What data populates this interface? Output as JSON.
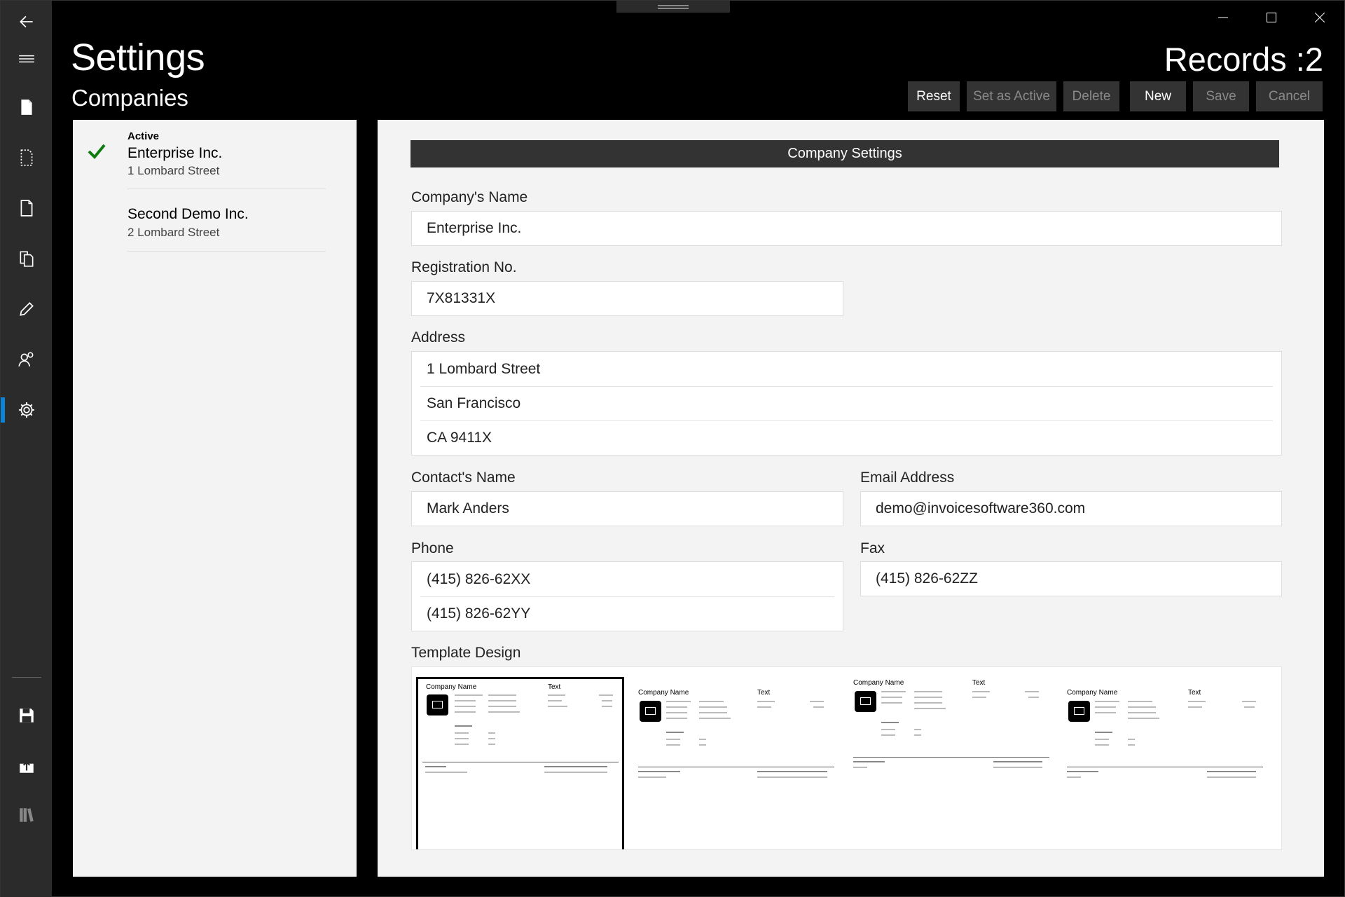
{
  "window": {
    "controls": [
      "minimize",
      "maximize",
      "close"
    ]
  },
  "nav": {
    "items": [
      {
        "icon": "back-arrow-icon"
      },
      {
        "icon": "hamburger-menu-icon"
      },
      {
        "icon": "document-icon"
      },
      {
        "icon": "document-dashed-icon"
      },
      {
        "icon": "document-outline-icon"
      },
      {
        "icon": "copy-documents-icon"
      },
      {
        "icon": "pencil-icon"
      },
      {
        "icon": "people-icon"
      },
      {
        "icon": "gear-icon",
        "selected": true
      },
      {
        "icon": "save-disk-icon"
      },
      {
        "icon": "upload-icon"
      },
      {
        "icon": "library-icon"
      }
    ],
    "accent_color": "#0A84D8"
  },
  "header": {
    "title": "Settings",
    "subtitle": "Companies",
    "records": "Records :2"
  },
  "toolbar": {
    "reset": "Reset",
    "set_active": "Set as Active",
    "delete": "Delete",
    "new": "New",
    "save": "Save",
    "cancel": "Cancel"
  },
  "companies": [
    {
      "tag": "Active",
      "name": "Enterprise Inc.",
      "address": "1 Lombard Street",
      "active": true
    },
    {
      "tag": "",
      "name": "Second Demo Inc.",
      "address": "2 Lombard Street",
      "active": false
    }
  ],
  "form": {
    "section_title": "Company Settings",
    "company_name_label": "Company's Name",
    "company_name": "Enterprise Inc.",
    "registration_label": "Registration No.",
    "registration": "7X81331X",
    "address_label": "Address",
    "address_lines": [
      "1 Lombard Street",
      "San Francisco",
      "CA 9411X"
    ],
    "contact_label": "Contact's Name",
    "contact": "Mark Anders",
    "email_label": "Email Address",
    "email": "demo@invoicesoftware360.com",
    "phone_label": "Phone",
    "phones": [
      "(415) 826-62XX",
      "(415) 826-62YY"
    ],
    "fax_label": "Fax",
    "fax": "(415) 826-62ZZ",
    "template_label": "Template Design"
  },
  "templates": [
    {
      "company_name": "Company Name",
      "text": "Text",
      "selected": true
    },
    {
      "company_name": "Company Name",
      "text": "Text",
      "selected": false
    },
    {
      "company_name": "Company Name",
      "text": "Text",
      "selected": false
    },
    {
      "company_name": "Company Name",
      "text": "Text",
      "selected": false
    }
  ],
  "colors": {
    "check": "#107C10",
    "panel": "#F3F3F3",
    "toolbar_button": "#333333"
  }
}
